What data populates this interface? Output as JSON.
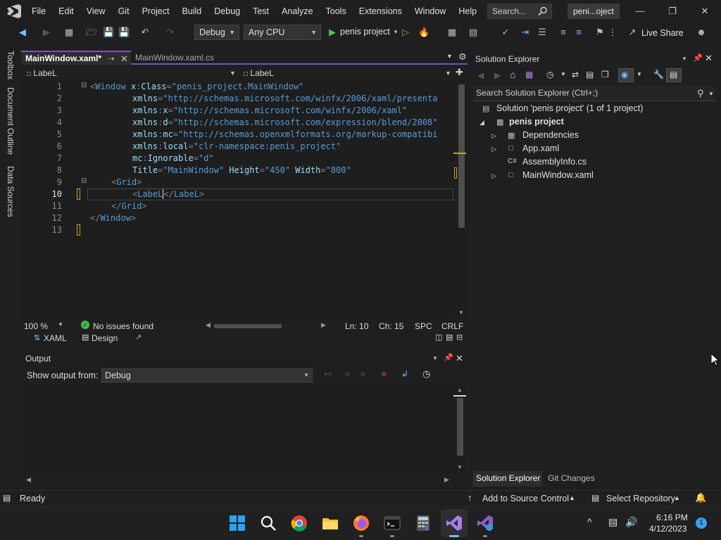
{
  "menu": [
    "File",
    "Edit",
    "View",
    "Git",
    "Project",
    "Build",
    "Debug",
    "Test",
    "Analyze",
    "Tools",
    "Extensions",
    "Window",
    "Help"
  ],
  "search_placeholder": "Search...",
  "solution_badge": "peni...oject",
  "toolbar": {
    "config": "Debug",
    "platform": "Any CPU",
    "run_target": "penis project",
    "live_share": "Live Share"
  },
  "left_tabs": [
    "Toolbox",
    "Document Outline",
    "Data Sources"
  ],
  "editor": {
    "tabs": [
      {
        "label": "MainWindow.xaml*",
        "active": true
      },
      {
        "label": "MainWindow.xaml.cs",
        "active": false
      }
    ],
    "nav_left": "LabeL",
    "nav_right": "LabeL",
    "line_numbers": [
      "1",
      "2",
      "3",
      "4",
      "5",
      "6",
      "7",
      "8",
      "9",
      "10",
      "11",
      "12",
      "13"
    ],
    "zoom": "100 %",
    "issues": "No issues found",
    "line": "Ln: 10",
    "col": "Ch: 15",
    "spc": "SPC",
    "eol": "CRLF",
    "bottom_tabs": [
      "XAML",
      "Design"
    ]
  },
  "code": {
    "l1_class": "\"penis_project.MainWindow\"",
    "l2_val": "\"http://schemas.microsoft.com/winfx/2006/xaml/presenta",
    "l3_val": "\"http://schemas.microsoft.com/winfx/2006/xaml\"",
    "l4_val": "\"http://schemas.microsoft.com/expression/blend/2008\"",
    "l5_val": "\"http://schemas.openxmlformats.org/markup-compatibi",
    "l6_val": "\"clr-namespace:penis_project\"",
    "l7_val": "\"d\"",
    "l8_title": "\"MainWindow\"",
    "l8_height": "\"450\"",
    "l8_width": "\"800\""
  },
  "output": {
    "title": "Output",
    "show_from_label": "Show output from:",
    "show_from_value": "Debug"
  },
  "solution_explorer": {
    "title": "Solution Explorer",
    "search_placeholder": "Search Solution Explorer (Ctrl+;)",
    "solution_label": "Solution 'penis project' (1 of 1 project)",
    "project": "penis project",
    "items": [
      "Dependencies",
      "App.xaml",
      "AssemblyInfo.cs",
      "MainWindow.xaml"
    ],
    "bottom_tabs": [
      "Solution Explorer",
      "Git Changes"
    ]
  },
  "statusbar": {
    "ready": "Ready",
    "source_control": "Add to Source Control",
    "select_repo": "Select Repository"
  },
  "taskbar": {
    "time": "6:16 PM",
    "date": "4/12/2023",
    "notification_count": "1"
  },
  "colors": {
    "accent": "#7f4ec0",
    "xaml_tag": "#569cd6",
    "xaml_attr": "#9cdcfe",
    "status_ok": "#3fb950"
  }
}
